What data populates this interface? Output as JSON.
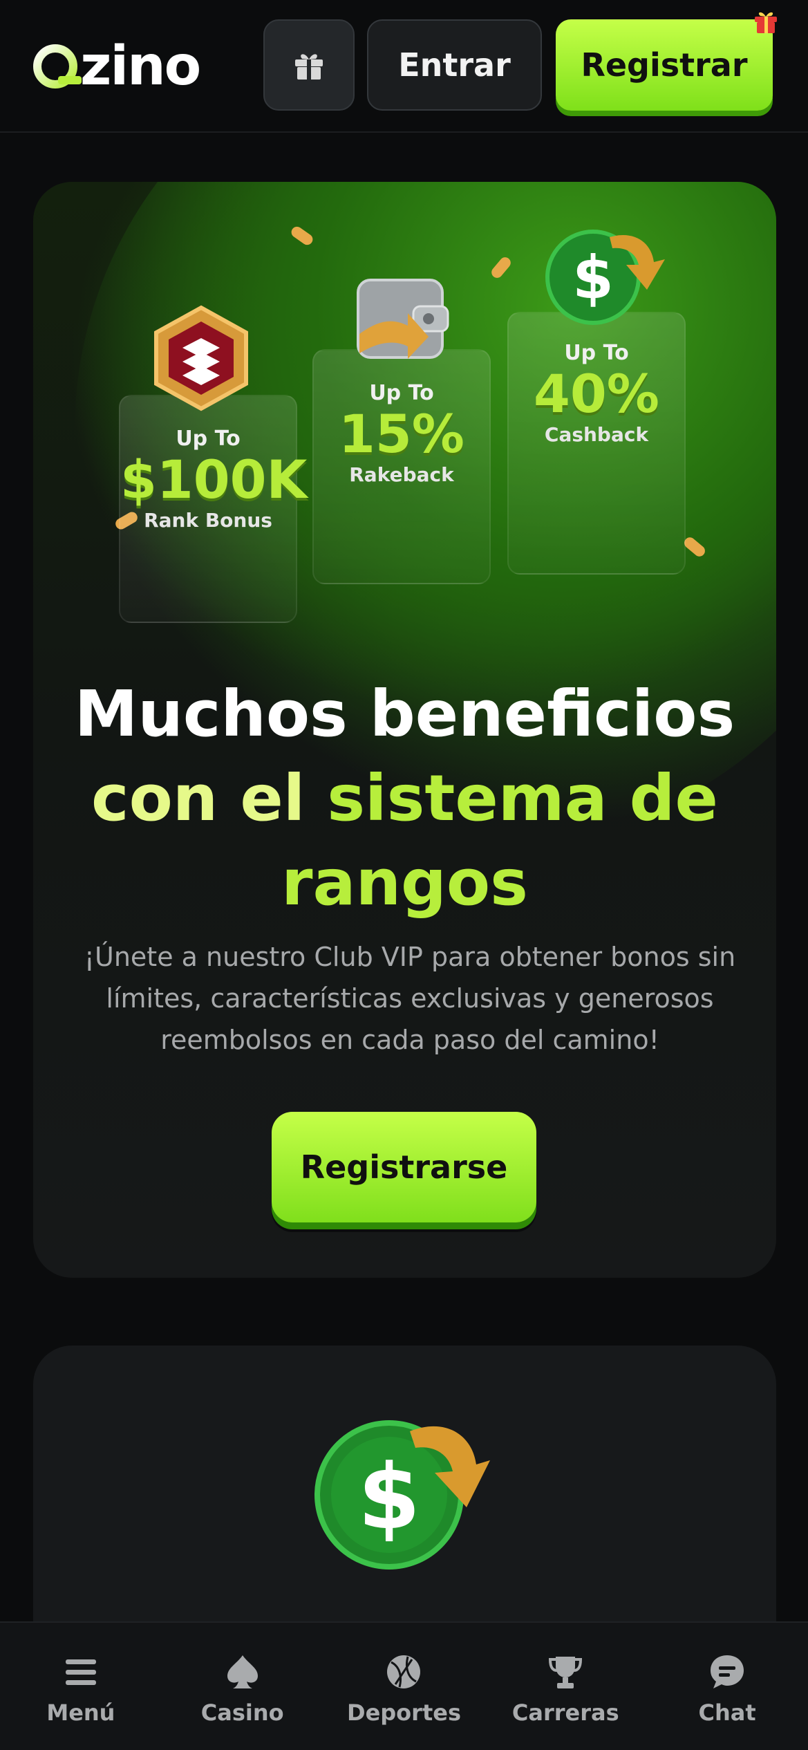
{
  "header": {
    "logo_text": "zino",
    "login_label": "Entrar",
    "register_label": "Registrar"
  },
  "promo": {
    "panels": [
      {
        "upto": "Up To",
        "value": "$100K",
        "label": "Rank Bonus"
      },
      {
        "upto": "Up To",
        "value": "15%",
        "label": "Rakeback"
      },
      {
        "upto": "Up To",
        "value": "40%",
        "label": "Cashback"
      }
    ],
    "headline_line1": "Muchos beneficios",
    "headline_line2a": "con el ",
    "headline_line2b": "sistema de",
    "headline_line3": "rangos",
    "description": "¡Únete a nuestro Club VIP para obtener bonos sin límites, características exclusivas y generosos reembolsos en cada paso del camino!",
    "cta_label": "Registrarse"
  },
  "bottom_nav": {
    "items": [
      {
        "label": "Menú",
        "icon": "menu-icon"
      },
      {
        "label": "Casino",
        "icon": "spade-icon"
      },
      {
        "label": "Deportes",
        "icon": "basketball-icon"
      },
      {
        "label": "Carreras",
        "icon": "trophy-icon"
      },
      {
        "label": "Chat",
        "icon": "chat-icon"
      }
    ]
  },
  "colors": {
    "accent": "#b7ee3c",
    "background": "#0b0c0d",
    "card": "#17191b"
  }
}
